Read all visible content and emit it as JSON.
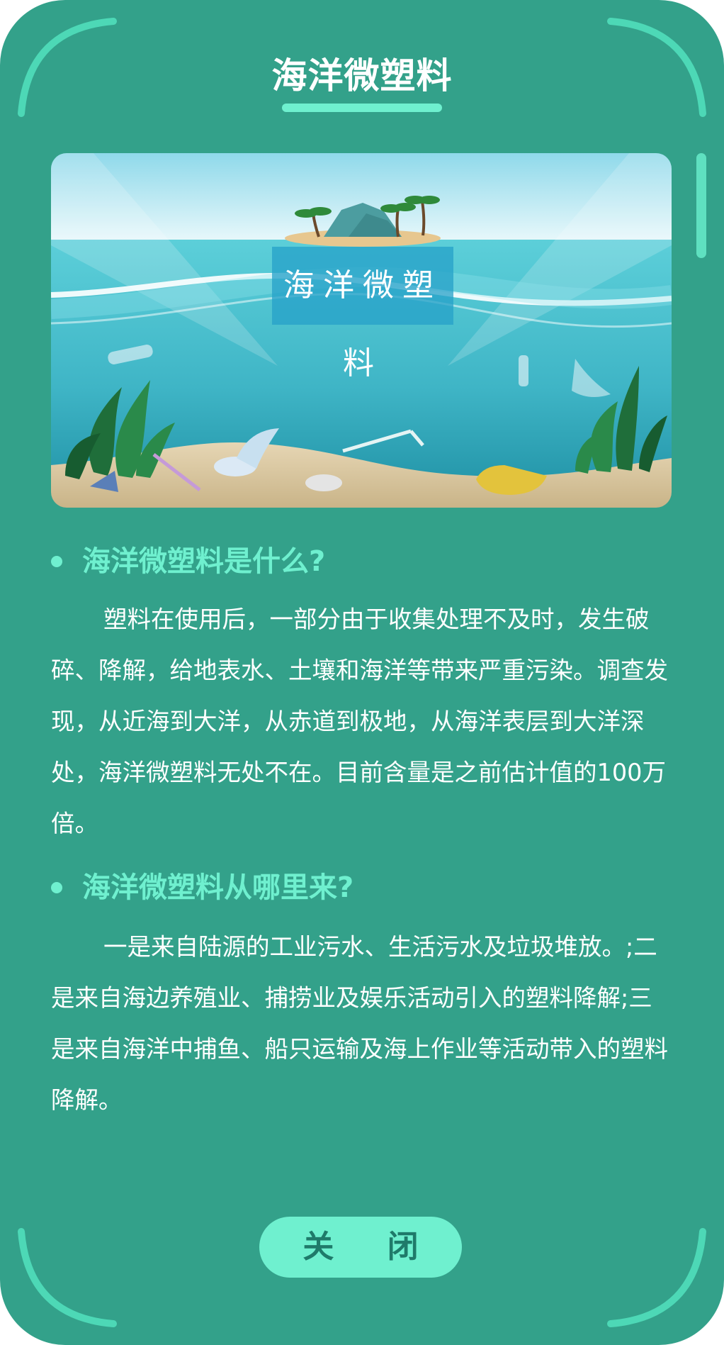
{
  "dialog": {
    "title": "海洋微塑料",
    "close_label": "关 闭"
  },
  "banner": {
    "label": "海洋微塑料"
  },
  "sections": [
    {
      "heading": "海洋微塑料是什么?",
      "body": "塑料在使用后，一部分由于收集处理不及时，发生破碎、降解，给地表水、土壤和海洋等带来严重污染。调查发现，从近海到大洋，从赤道到极地，从海洋表层到大洋深处，海洋微塑料无处不在。目前含量是之前估计值的100万倍。"
    },
    {
      "heading": "海洋微塑料从哪里来?",
      "body": "一是来自陆源的工业污水、生活污水及垃圾堆放。;二是来自海边养殖业、捕捞业及娱乐活动引入的塑料降解;三是来自海洋中捕鱼、船只运输及海上作业等活动带入的塑料降解。"
    }
  ],
  "colors": {
    "background": "#33a18a",
    "accent": "#6ff0cf",
    "text": "#ffffff"
  }
}
